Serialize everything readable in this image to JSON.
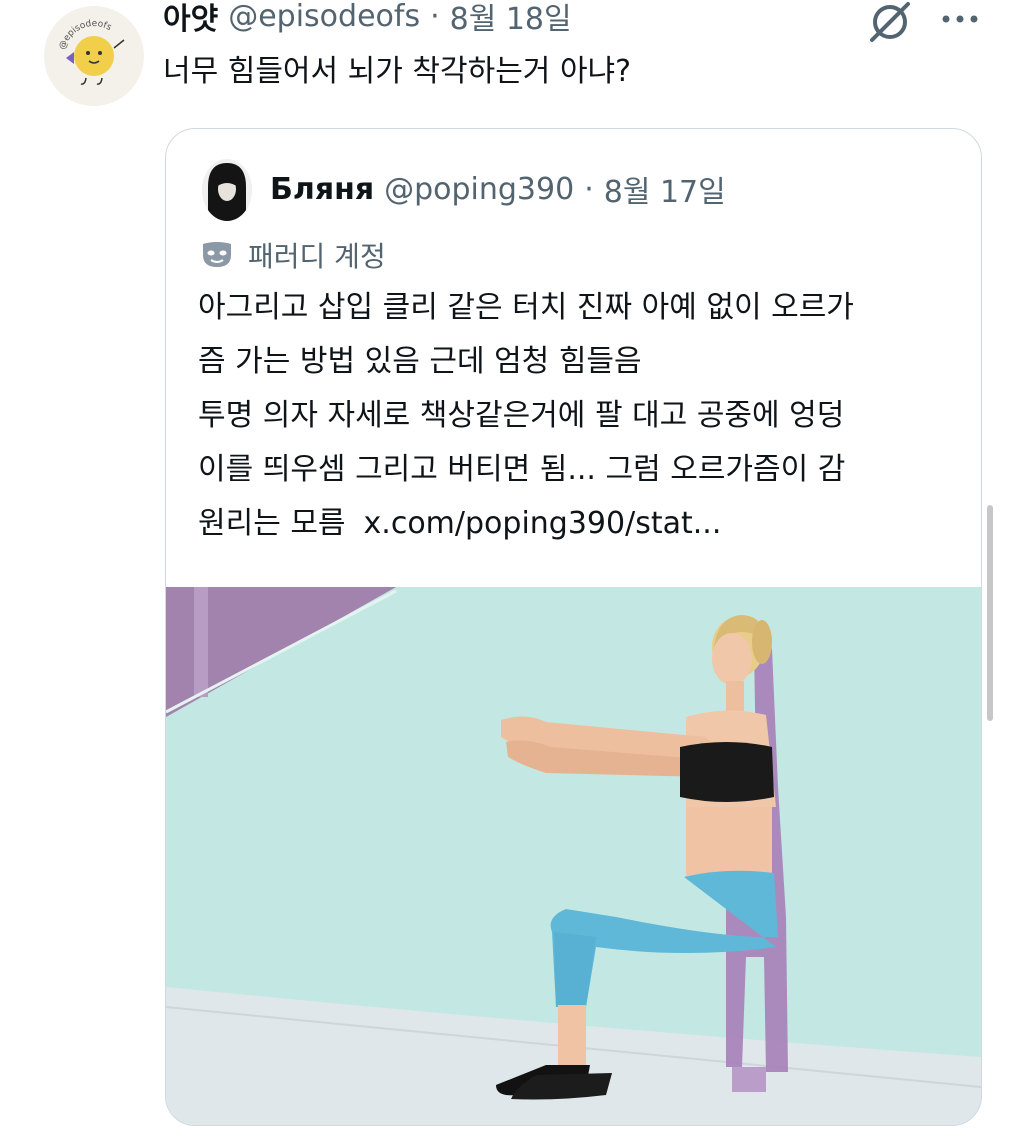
{
  "tweet": {
    "display_name": "아얏",
    "handle": "@episodeofs",
    "separator": "·",
    "date": "8월 18일",
    "text": "너무 힘들어서 뇌가 착각하는거 아냐?",
    "avatar_text": "@episodeofs",
    "icons": {
      "grok": "grok-icon",
      "more": "more-icon"
    }
  },
  "quote": {
    "display_name": "Бляня",
    "handle": "@poping390",
    "separator": "·",
    "date": "8월 17일",
    "parody_label": "패러디 계정",
    "text_lines": [
      "아그리고 삽입 클리 같은 터치 진짜 아예 없이 오르가",
      "즘 가는 방법 있음 근데 엄청 힘들음",
      "투명 의자 자세로 책상같은거에 팔 대고 공중에 엉덩",
      "이를 띄우셈 그리고 버티면 됨... 그럼 오르가즘이 감"
    ],
    "last_line_prefix": "원리는 모름",
    "link_text": "x.com/poping390/stat..."
  },
  "colors": {
    "text": "#0f1419",
    "secondary": "#536471",
    "border": "#cfd9de"
  }
}
